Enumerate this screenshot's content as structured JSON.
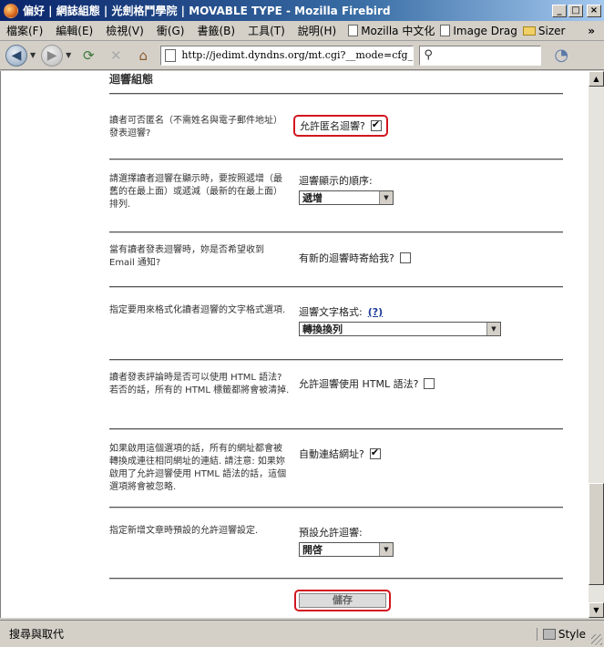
{
  "window": {
    "title": "偏好 | 網誌組態 | 光劍格鬥學院 | MOVABLE TYPE - Mozilla Firebird",
    "buttons": {
      "minimize": "_",
      "maximize": "□",
      "close": "×"
    }
  },
  "menubar": {
    "items": [
      "檔案(F)",
      "編輯(E)",
      "檢視(V)",
      "衝(G)",
      "書籤(B)",
      "工具(T)",
      "說明(H)"
    ],
    "bookmarks": [
      "Mozilla 中文化",
      "Image Drag",
      "Sizer"
    ],
    "more": "»"
  },
  "navbar": {
    "url": "http://jedimt.dyndns.org/mt.cgi?__mode=cfg_prefs&",
    "search_value": ""
  },
  "section": {
    "title": "迴響組態"
  },
  "rows": [
    {
      "desc": "讀者可否匿名（不需姓名與電子郵件地址）發表迴響?",
      "label": "允許匿名迴響?",
      "checked": true
    },
    {
      "desc": "請選擇讀者迴響在顯示時，要按照遞增（最舊的在最上面）或遞減（最新的在最上面）排列.",
      "label": "迴響顯示的順序:",
      "selected": "遞增"
    },
    {
      "desc": "當有讀者發表迴響時，妳是否希望收到 Email 通知?",
      "label": "有新的迴響時寄給我?",
      "checked": false
    },
    {
      "desc": "指定要用來格式化讀者迴響的文字格式選項.",
      "label": "迴響文字格式:",
      "help": "(?)",
      "selected": "轉換換列"
    },
    {
      "desc": "讀者發表評論時是否可以使用 HTML 語法? 若否的話，所有的 HTML 標籤都將會被清掉.",
      "label": "允許迴響使用 HTML 語法?",
      "checked": false
    },
    {
      "desc": "如果啟用這個選項的話，所有的網址都會被轉換成連往相同網址的連結. 請注意: 如果妳啟用了允許迴響使用 HTML 語法的話，這個選項將會被忽略.",
      "label": "自動連結網址?",
      "checked": true
    },
    {
      "desc": "指定新增文章時預設的允許迴響設定.",
      "label": "預設允許迴響:",
      "selected": "開啓"
    }
  ],
  "save_button": "儲存",
  "statusbar": {
    "text": "搜尋與取代",
    "style_label": "Style"
  },
  "colors": {
    "highlight": "#d2161e",
    "titlebar": "#0a246a"
  }
}
